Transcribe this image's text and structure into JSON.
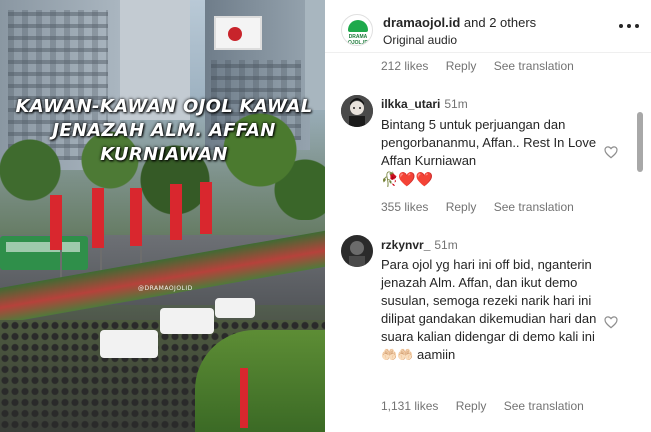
{
  "video": {
    "overlay_title": "KAWAN-KAWAN OJOL KAWAL JENAZAH ALM. AFFAN KURNIAWAN",
    "watermark": "@DRAMAOJOLID"
  },
  "header": {
    "username": "dramaojol.id",
    "and_others": " and 2 others",
    "subtitle": "Original audio",
    "avatar_text": "DRAMA OJOL.ID",
    "more_icon": "more-horizontal-icon"
  },
  "top_meta": {
    "likes": "212 likes",
    "reply": "Reply",
    "see_translation": "See translation"
  },
  "comments": [
    {
      "username": "ilkka_utari",
      "time": "51m",
      "text": "Bintang 5 untuk perjuangan dan pengorbananmu, Affan.. Rest In Love Affan Kurniawan",
      "emoji": "🥀❤️❤️",
      "likes": "355 likes",
      "reply": "Reply",
      "see_translation": "See translation"
    },
    {
      "username": "rzkynvr_",
      "time": "51m",
      "text": "Para ojol yg hari ini off bid, nganterin jenazah Alm. Affan, dan ikut demo susulan, semoga rezeki narik hari ini dilipat gandakan dikemudian hari dan suara kalian didengar di demo kali ini 🤲🏻🤲🏻 aamiin",
      "likes": "1,131 likes",
      "reply": "Reply",
      "see_translation": "See translation"
    }
  ],
  "colors": {
    "text": "#262626",
    "secondary": "#737373",
    "brand_green": "#1ea94b"
  }
}
